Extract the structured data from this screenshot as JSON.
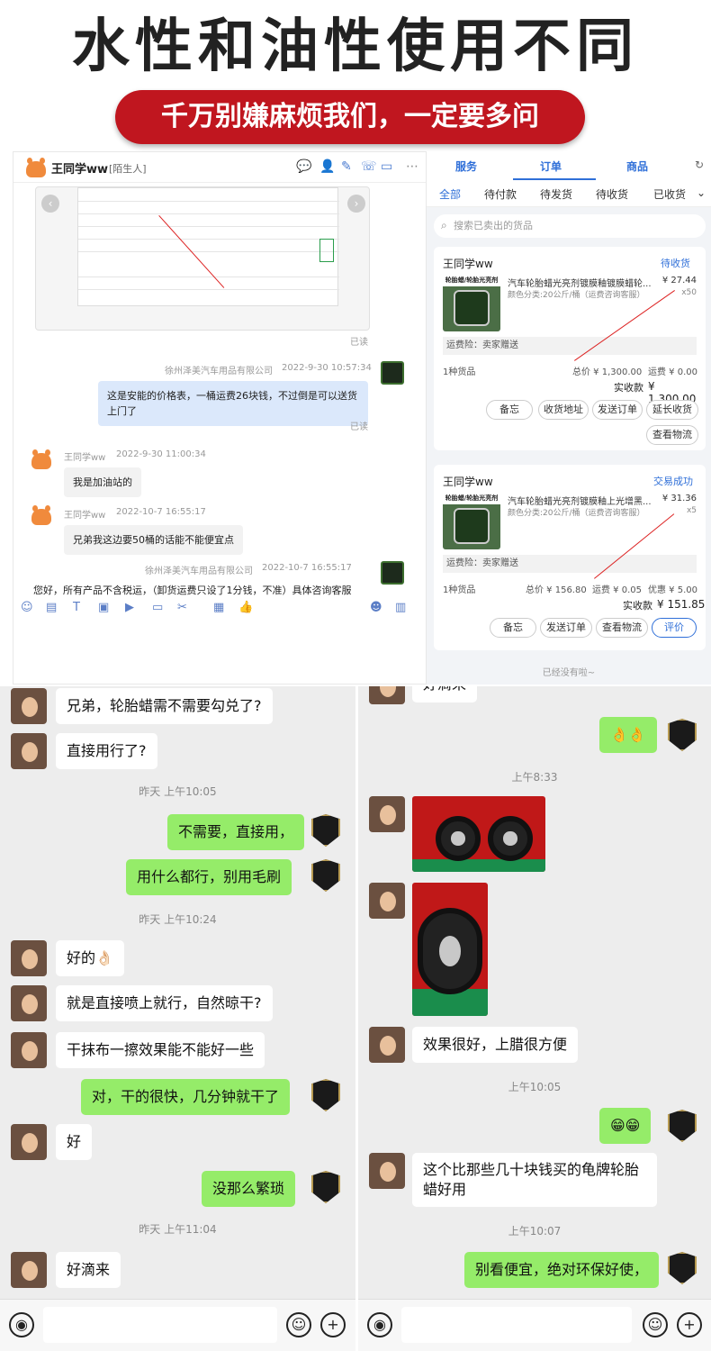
{
  "hero": {
    "title": "水性和油性使用不同",
    "subtitle": "千万别嫌麻烦我们，一定要多问"
  },
  "pc_chat": {
    "contact_name": "王同学ww",
    "contact_tag": "[陌生人]",
    "read_label": "已读",
    "messages": [
      {
        "sender": "徐州泽美汽车用品有限公司",
        "time": "2022-9-30 10:57:34",
        "text": "这是安能的价格表，一桶运费26块钱，不过倒是可以送货上门了",
        "status": "已读"
      },
      {
        "sender": "王同学ww",
        "time": "2022-9-30 11:00:34",
        "text": "我是加油站的"
      },
      {
        "sender": "王同学ww",
        "time": "2022-10-7 16:55:17",
        "text": "兄弟我这边要50桶的话能不能便宜点"
      },
      {
        "sender": "徐州泽美汽车用品有限公司",
        "time": "2022-10-7 16:55:17",
        "text": "您好，所有产品不含税运，（卸货运费只设了1分钱，不准）具体咨询客服"
      }
    ]
  },
  "orders": {
    "tabs": [
      "服务",
      "订单",
      "商品"
    ],
    "subtabs": [
      "全部",
      "待付款",
      "待发货",
      "待收货",
      "已收货"
    ],
    "search_placeholder": "搜索已卖出的货品",
    "cards": [
      {
        "buyer": "王同学ww",
        "status": "待收货",
        "product_label": "轮胎蜡/轮胎光亮剂",
        "title": "汽车轮胎蜡光亮剂镀膜釉镀膜蜡轮...",
        "spec": "颜色分类:20公斤/桶（运费咨询客服）",
        "price": "¥ 27.44",
        "qty": "x50",
        "insurance": "运费险：卖家赠送",
        "count": "1种货品",
        "total": "总价 ¥ 1,300.00",
        "shipping": "运费 ¥ 0.00",
        "discount": "",
        "paid_label": "实收款",
        "paid": "¥ 1,300.00",
        "buttons": [
          "备忘",
          "收货地址",
          "发送订单",
          "延长收货",
          "查看物流"
        ]
      },
      {
        "buyer": "王同学ww",
        "status": "交易成功",
        "product_label": "轮胎蜡/轮胎光亮剂",
        "title": "汽车轮胎蜡光亮剂镀膜釉上光增黑...",
        "spec": "颜色分类:20公斤/桶（运费咨询客服）",
        "price": "¥ 31.36",
        "qty": "x5",
        "insurance": "运费险：卖家赠送",
        "count": "1种货品",
        "total": "总价 ¥ 156.80",
        "shipping": "运费 ¥ 0.05",
        "discount": "优惠 ¥ 5.00",
        "paid_label": "实收款",
        "paid": "¥ 151.85",
        "buttons": [
          "备忘",
          "发送订单",
          "查看物流",
          "评价"
        ]
      }
    ],
    "footer": "已经没有啦~"
  },
  "phone_left": {
    "messages": [
      {
        "side": "left",
        "text": "兄弟，轮胎蜡需不需要勾兑了?"
      },
      {
        "side": "left",
        "text": "直接用行了?"
      },
      {
        "side": "time",
        "text": "昨天 上午10:05"
      },
      {
        "side": "right",
        "text": "不需要，直接用，"
      },
      {
        "side": "right",
        "text": "用什么都行，别用毛刷"
      },
      {
        "side": "time",
        "text": "昨天 上午10:24"
      },
      {
        "side": "left",
        "text": "好的👌🏻"
      },
      {
        "side": "left",
        "text": "就是直接喷上就行，自然晾干?"
      },
      {
        "side": "left",
        "text": "干抹布一擦效果能不能好一些"
      },
      {
        "side": "right",
        "text": "对，干的很快，几分钟就干了"
      },
      {
        "side": "left",
        "text": "好"
      },
      {
        "side": "right",
        "text": "没那么繁琐"
      },
      {
        "side": "time",
        "text": "昨天 上午11:04"
      },
      {
        "side": "left",
        "text": "好滴来"
      }
    ]
  },
  "phone_right": {
    "messages": [
      {
        "side": "left",
        "text": "好滴来"
      },
      {
        "side": "right",
        "text": "👌👌"
      },
      {
        "side": "time",
        "text": "上午8:33"
      },
      {
        "side": "left",
        "text": "效果很好，上腊很方便"
      },
      {
        "side": "time",
        "text": "上午10:05"
      },
      {
        "side": "right",
        "text": "😁😁"
      },
      {
        "side": "left",
        "text": "这个比那些几十块钱买的龟牌轮胎蜡好用"
      },
      {
        "side": "time",
        "text": "上午10:07"
      },
      {
        "side": "right",
        "text": "别看便宜，绝对环保好使，"
      }
    ]
  },
  "colors": {
    "hero_red": "#c0161f",
    "wechat_green": "#95ec69",
    "link_blue": "#2f6fd8"
  }
}
